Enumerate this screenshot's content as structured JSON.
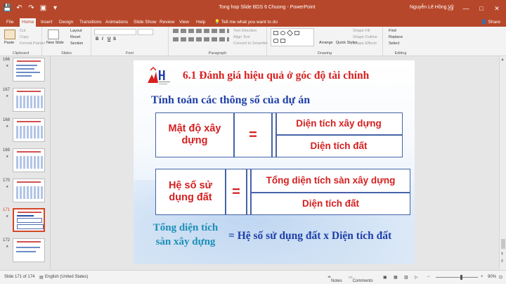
{
  "titlebar": {
    "title": "Tong hop Slide BDS 6 Chuong  -  PowerPoint",
    "user": "Nguyễn Lê Hồng Vỹ",
    "qat": [
      "💾",
      "↶",
      "↷",
      "▣",
      "▾"
    ],
    "window_buttons": [
      "▭",
      "—",
      "□",
      "✕"
    ]
  },
  "tabs": [
    "File",
    "Home",
    "Insert",
    "Design",
    "Transitions",
    "Animations",
    "Slide Show",
    "Review",
    "View",
    "Help"
  ],
  "tell_me": "Tell me what you want to do",
  "share": "Share",
  "ribbon": {
    "clipboard": {
      "label": "Clipboard",
      "paste": "Paste",
      "cut": "Cut",
      "copy": "Copy",
      "format_painter": "Format Painter"
    },
    "slides": {
      "label": "Slides",
      "new_slide": "New Slide",
      "layout": "Layout",
      "reset": "Reset",
      "section": "Section"
    },
    "font": {
      "label": "Font",
      "bold": "B",
      "italic": "I",
      "underline": "U",
      "strike": "S"
    },
    "paragraph": {
      "label": "Paragraph",
      "text_direction": "Text Direction",
      "align_text": "Align Text",
      "convert_smartart": "Convert to SmartArt"
    },
    "drawing": {
      "label": "Drawing",
      "arrange": "Arrange",
      "quick_styles": "Quick Styles",
      "shape_fill": "Shape Fill",
      "shape_outline": "Shape Outline",
      "shape_effects": "Shape Effects"
    },
    "editing": {
      "label": "Editing",
      "find": "Find",
      "replace": "Replace",
      "select": "Select"
    }
  },
  "thumbnails": [
    {
      "num": "166",
      "star": "★"
    },
    {
      "num": "167",
      "star": "★"
    },
    {
      "num": "168",
      "star": "★"
    },
    {
      "num": "169",
      "star": "★"
    },
    {
      "num": "170",
      "star": "★"
    },
    {
      "num": "171",
      "star": "★"
    },
    {
      "num": "172",
      "star": "★"
    }
  ],
  "slide": {
    "title": "6.1 Đánh giá hiệu quả ở góc độ tài chính",
    "subtitle": "Tính toán các thông số của dự án",
    "formula1": {
      "left": "Mật độ xây dựng",
      "eq": "=",
      "numerator": "Diện tích xây dựng",
      "denominator": "Diện tích đất"
    },
    "formula2": {
      "left": "Hệ số sử dụng đất",
      "eq": "=",
      "numerator": "Tổng diện tích sàn xây dựng",
      "denominator": "Diện tích đất"
    },
    "bottom_left": "Tổng diện tích sàn xây dựng",
    "bottom_right": "= Hệ số sử dụng đất x Diện tích đất"
  },
  "status": {
    "slide_info": "Slide 171 of 174",
    "language": "English (United States)",
    "notes": "Notes",
    "comments": "Comments",
    "zoom": "90%"
  },
  "colors": {
    "accent": "#b7472a",
    "title_red": "#d82020",
    "navy": "#1f3fa8",
    "teal": "#1d8fb7",
    "border": "#4563a8"
  }
}
